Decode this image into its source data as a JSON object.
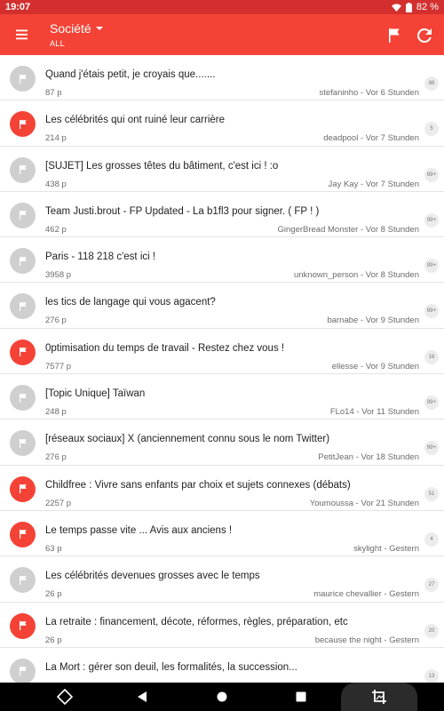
{
  "status_bar": {
    "time": "19:07",
    "battery": "82 %"
  },
  "app_bar": {
    "title": "Société",
    "subtitle": "ALL"
  },
  "topics": [
    {
      "title": "Quand j'étais petit, je croyais que.......",
      "count": "87 p",
      "author": "stefaninho",
      "time": "Vor 6 Stunden",
      "badge": "88",
      "flag": "grey"
    },
    {
      "title": "Les célébrités qui ont ruiné leur carrière",
      "count": "214 p",
      "author": "deadpool",
      "time": "Vor 7 Stunden",
      "badge": "5",
      "flag": "red"
    },
    {
      "title": "[SUJET] Les grosses têtes du bâtiment, c'est ici ! :o",
      "count": "438 p",
      "author": "Jay Kay",
      "time": "Vor 7 Stunden",
      "badge": "99+",
      "flag": "grey"
    },
    {
      "title": "Team Justi.brout - FP Updated - La b1fl3 pour signer. ( FP ! )",
      "count": "462 p",
      "author": "GingerBread Monster",
      "time": "Vor 8 Stunden",
      "badge": "99+",
      "flag": "grey"
    },
    {
      "title": "Paris - 118 218 c'est ici !",
      "count": "3958 p",
      "author": "unknown_person",
      "time": "Vor 8 Stunden",
      "badge": "99+",
      "flag": "grey"
    },
    {
      "title": "les tics de langage qui vous agacent?",
      "count": "276 p",
      "author": "barnabe",
      "time": "Vor 9 Stunden",
      "badge": "99+",
      "flag": "grey"
    },
    {
      "title": "0ptimisation du temps de travail - Restez chez vous !",
      "count": "7577 p",
      "author": "ellesse",
      "time": "Vor 9 Stunden",
      "badge": "16",
      "flag": "red"
    },
    {
      "title": "[Topic Unique] Taïwan",
      "count": "248 p",
      "author": "FLo14",
      "time": "Vor 11 Stunden",
      "badge": "99+",
      "flag": "grey"
    },
    {
      "title": "[réseaux sociaux] X (anciennement connu sous le nom Twitter)",
      "count": "276 p",
      "author": "PetitJean",
      "time": "Vor 18 Stunden",
      "badge": "99+",
      "flag": "grey"
    },
    {
      "title": "Childfree : Vivre sans enfants par choix et sujets connexes (débats)",
      "count": "2257 p",
      "author": "Youmoussa",
      "time": "Vor 21 Stunden",
      "badge": "51",
      "flag": "red"
    },
    {
      "title": "Le temps passe vite ... Avis aux anciens !",
      "count": "63 p",
      "author": "skylight",
      "time": "Gestern",
      "badge": "4",
      "flag": "red"
    },
    {
      "title": "Les célébrités devenues grosses avec le temps",
      "count": "26 p",
      "author": "maurice chevallier",
      "time": "Gestern",
      "badge": "27",
      "flag": "grey"
    },
    {
      "title": "La retraite : financement, décote, réformes, règles, préparation, etc",
      "count": "26 p",
      "author": "because the night",
      "time": "Gestern",
      "badge": "20",
      "flag": "red"
    },
    {
      "title": "La Mort : gérer son deuil, les formalités, la succession...",
      "count": "",
      "author": "",
      "time": "",
      "badge": "13",
      "flag": "grey"
    }
  ],
  "colors": {
    "primary": "#f44336",
    "status_bar": "#d32f2f",
    "flag_grey": "#cfcfcf",
    "flag_red": "#f44336"
  }
}
